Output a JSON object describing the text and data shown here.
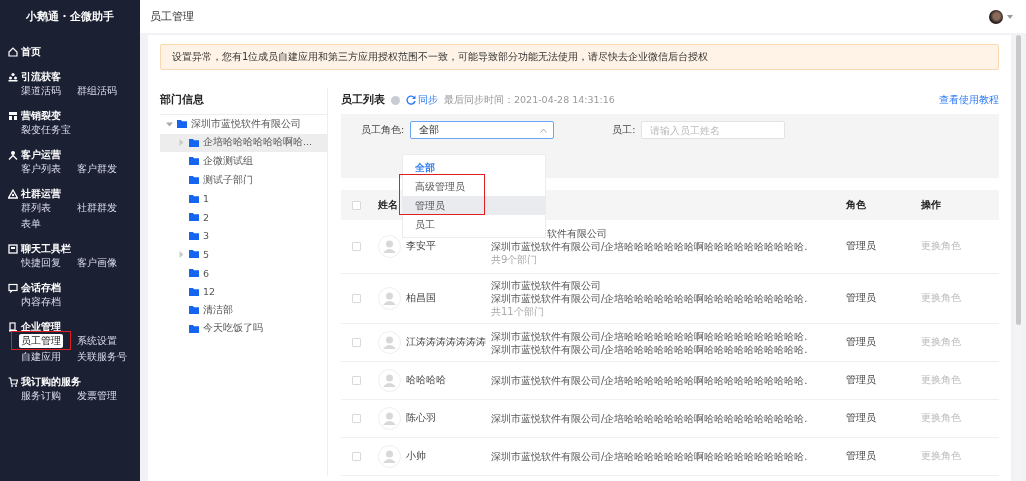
{
  "sidebar": {
    "brand": "小鹅通 · 企微助手",
    "sections": [
      {
        "title": "首页"
      },
      {
        "title": "引流获客",
        "items": [
          {
            "label": "渠道活码",
            "selected": false
          },
          {
            "label": "群组活码",
            "selected": false
          }
        ]
      },
      {
        "title": "营销裂变",
        "items": [
          {
            "label": "裂变任务宝",
            "selected": false
          }
        ]
      },
      {
        "title": "客户运营",
        "items": [
          {
            "label": "客户列表",
            "selected": false
          },
          {
            "label": "客户群发",
            "selected": false
          }
        ]
      },
      {
        "title": "社群运营",
        "items": [
          {
            "label": "群列表",
            "selected": false
          },
          {
            "label": "社群群发",
            "selected": false
          },
          {
            "label": "表单",
            "selected": false
          }
        ]
      },
      {
        "title": "聊天工具栏",
        "items": [
          {
            "label": "快捷回复",
            "selected": false
          },
          {
            "label": "客户画像",
            "selected": false
          }
        ]
      },
      {
        "title": "会话存档",
        "items": [
          {
            "label": "内容存档",
            "selected": false
          }
        ]
      },
      {
        "title": "企业管理",
        "items": [
          {
            "label": "员工管理",
            "selected": true
          },
          {
            "label": "系统设置",
            "selected": false
          },
          {
            "label": "自建应用",
            "selected": false
          },
          {
            "label": "关联服务号",
            "selected": false
          }
        ]
      },
      {
        "title": "我订购的服务",
        "items": [
          {
            "label": "服务订购",
            "selected": false
          },
          {
            "label": "发票管理",
            "selected": false
          }
        ]
      }
    ]
  },
  "header": {
    "title": "员工管理"
  },
  "alert": "设置异常，您有1位成员自建应用和第三方应用授权范围不一致，可能导致部分功能无法使用，请尽快去企业微信后台授权",
  "departments": {
    "title": "部门信息",
    "tree": [
      {
        "label": "深圳市蓝悦软件有限公司",
        "expanded": true,
        "selected": false,
        "children": [
          {
            "label": "企培哈哈哈哈哈哈啊哈...",
            "expanded": false,
            "selected": true
          },
          {
            "label": "企微测试组",
            "selected": false
          },
          {
            "label": "测试子部门",
            "selected": false
          },
          {
            "label": "1",
            "selected": false
          },
          {
            "label": "2",
            "selected": false
          },
          {
            "label": "3",
            "selected": false
          },
          {
            "label": "5",
            "expanded": false,
            "selected": false
          },
          {
            "label": "6",
            "selected": false
          },
          {
            "label": "12",
            "selected": false
          },
          {
            "label": "清洁部",
            "selected": false
          },
          {
            "label": "今天吃饭了吗",
            "selected": false
          }
        ]
      }
    ]
  },
  "staff": {
    "title": "员工列表",
    "sync": "同步",
    "last_sync": "最后同步时间：2021-04-28 14:31:16",
    "tutorial_link": "查看使用教程",
    "filters": {
      "role_label": "员工角色:",
      "role_value": "全部",
      "name_label": "员工:",
      "name_placeholder": "请输入员工姓名"
    },
    "role_dropdown": [
      {
        "label": "全部",
        "selected": true,
        "highlighted": false
      },
      {
        "label": "高级管理员",
        "selected": false,
        "highlighted": false
      },
      {
        "label": "管理员",
        "selected": false,
        "highlighted": true
      },
      {
        "label": "员工",
        "selected": false,
        "highlighted": false
      }
    ],
    "table": {
      "header_checked": false,
      "columns": [
        "姓名",
        "角色",
        "操作"
      ],
      "rows": [
        {
          "checked": false,
          "name": "李安平",
          "departments": [
            "软件有限公司",
            "深圳市蓝悦软件有限公司/企培哈哈哈哈哈哈哈啊哈哈哈哈哈哈哈哈哈哈."
          ],
          "count": "共9个部门",
          "role": "管理员",
          "action": "更换角色"
        },
        {
          "checked": false,
          "name": "柏昌国",
          "departments": [
            "深圳市蓝悦软件有限公司",
            "深圳市蓝悦软件有限公司/企培哈哈哈哈哈哈哈啊哈哈哈哈哈哈哈哈哈哈."
          ],
          "count": "共11个部门",
          "role": "管理员",
          "action": "更换角色"
        },
        {
          "checked": false,
          "name": "江涛涛涛涛涛涛涛",
          "departments": [
            "深圳市蓝悦软件有限公司/企培哈哈哈哈哈哈哈啊哈哈哈哈哈哈哈哈哈哈.",
            "深圳市蓝悦软件有限公司/企培哈哈哈哈哈哈哈啊哈哈哈哈哈哈哈哈哈哈."
          ],
          "role": "管理员",
          "action": "更换角色"
        },
        {
          "checked": false,
          "name": "哈哈哈哈",
          "departments": [
            "深圳市蓝悦软件有限公司/企培哈哈哈哈哈哈哈啊哈哈哈哈哈哈哈哈哈哈."
          ],
          "role": "管理员",
          "action": "更换角色"
        },
        {
          "checked": false,
          "name": "陈心羽",
          "departments": [
            "深圳市蓝悦软件有限公司/企培哈哈哈哈哈哈哈啊哈哈哈哈哈哈哈哈哈哈."
          ],
          "role": "管理员",
          "action": "更换角色"
        },
        {
          "checked": false,
          "name": "小帅",
          "departments": [
            "深圳市蓝悦软件有限公司/企培哈哈哈哈哈哈哈啊哈哈哈哈哈哈哈哈哈哈."
          ],
          "role": "管理员",
          "action": "更换角色"
        }
      ]
    }
  }
}
